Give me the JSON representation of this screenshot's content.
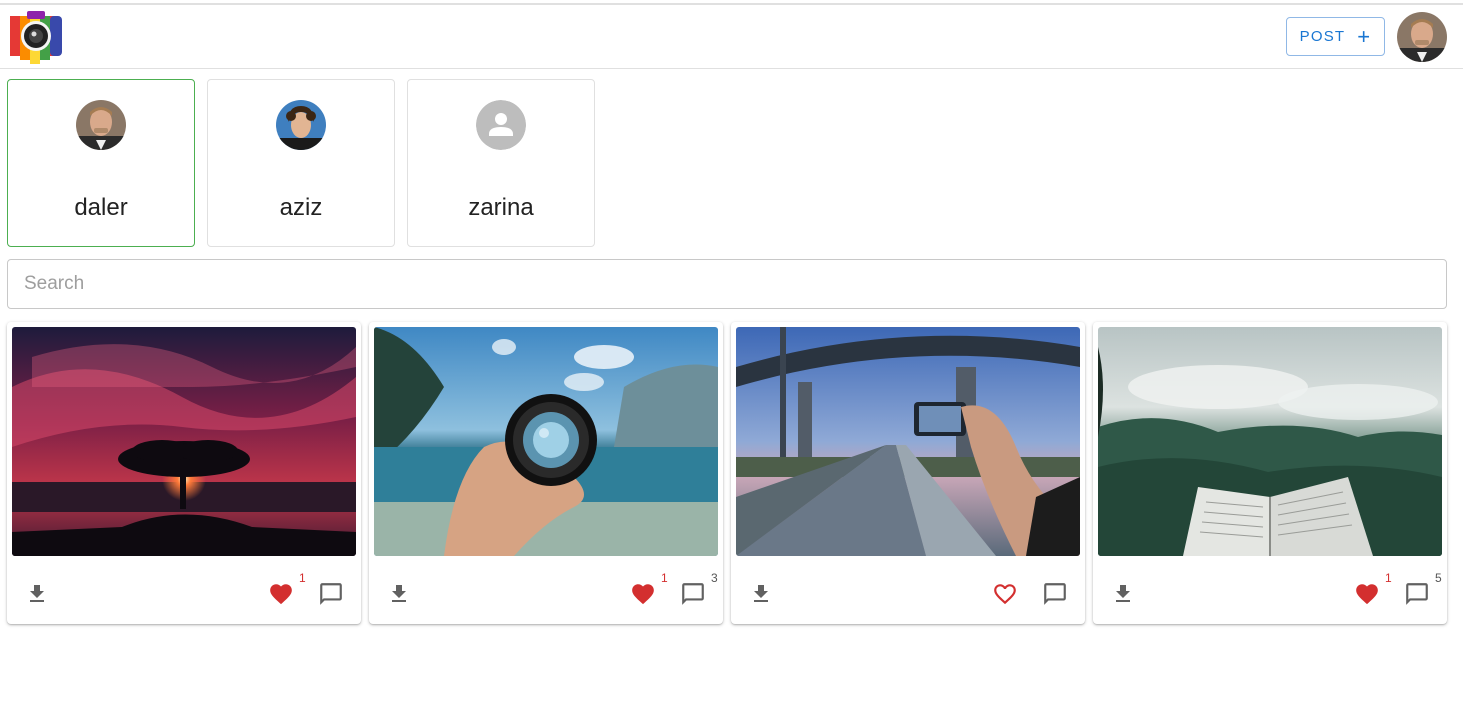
{
  "header": {
    "post_label": "POST",
    "post_icon": "plus-icon"
  },
  "users": [
    {
      "name": "daler",
      "selected": true,
      "avatar": "photo"
    },
    {
      "name": "aziz",
      "selected": false,
      "avatar": "photo"
    },
    {
      "name": "zarina",
      "selected": false,
      "avatar": "default-person-icon"
    }
  ],
  "search": {
    "placeholder": "Search",
    "value": ""
  },
  "posts": [
    {
      "photo": "tree-sunset",
      "liked": true,
      "likes": "1",
      "comments": ""
    },
    {
      "photo": "lens-over-lake",
      "liked": true,
      "likes": "1",
      "comments": "3"
    },
    {
      "photo": "phone-photo-bridge",
      "liked": false,
      "likes": "",
      "comments": ""
    },
    {
      "photo": "book-misty-forest",
      "liked": true,
      "likes": "1",
      "comments": "5"
    }
  ],
  "colors": {
    "accent": "#1976d2",
    "selected_border": "#4caf50",
    "like_red": "#d32f2f",
    "icon_gray": "#616161"
  }
}
